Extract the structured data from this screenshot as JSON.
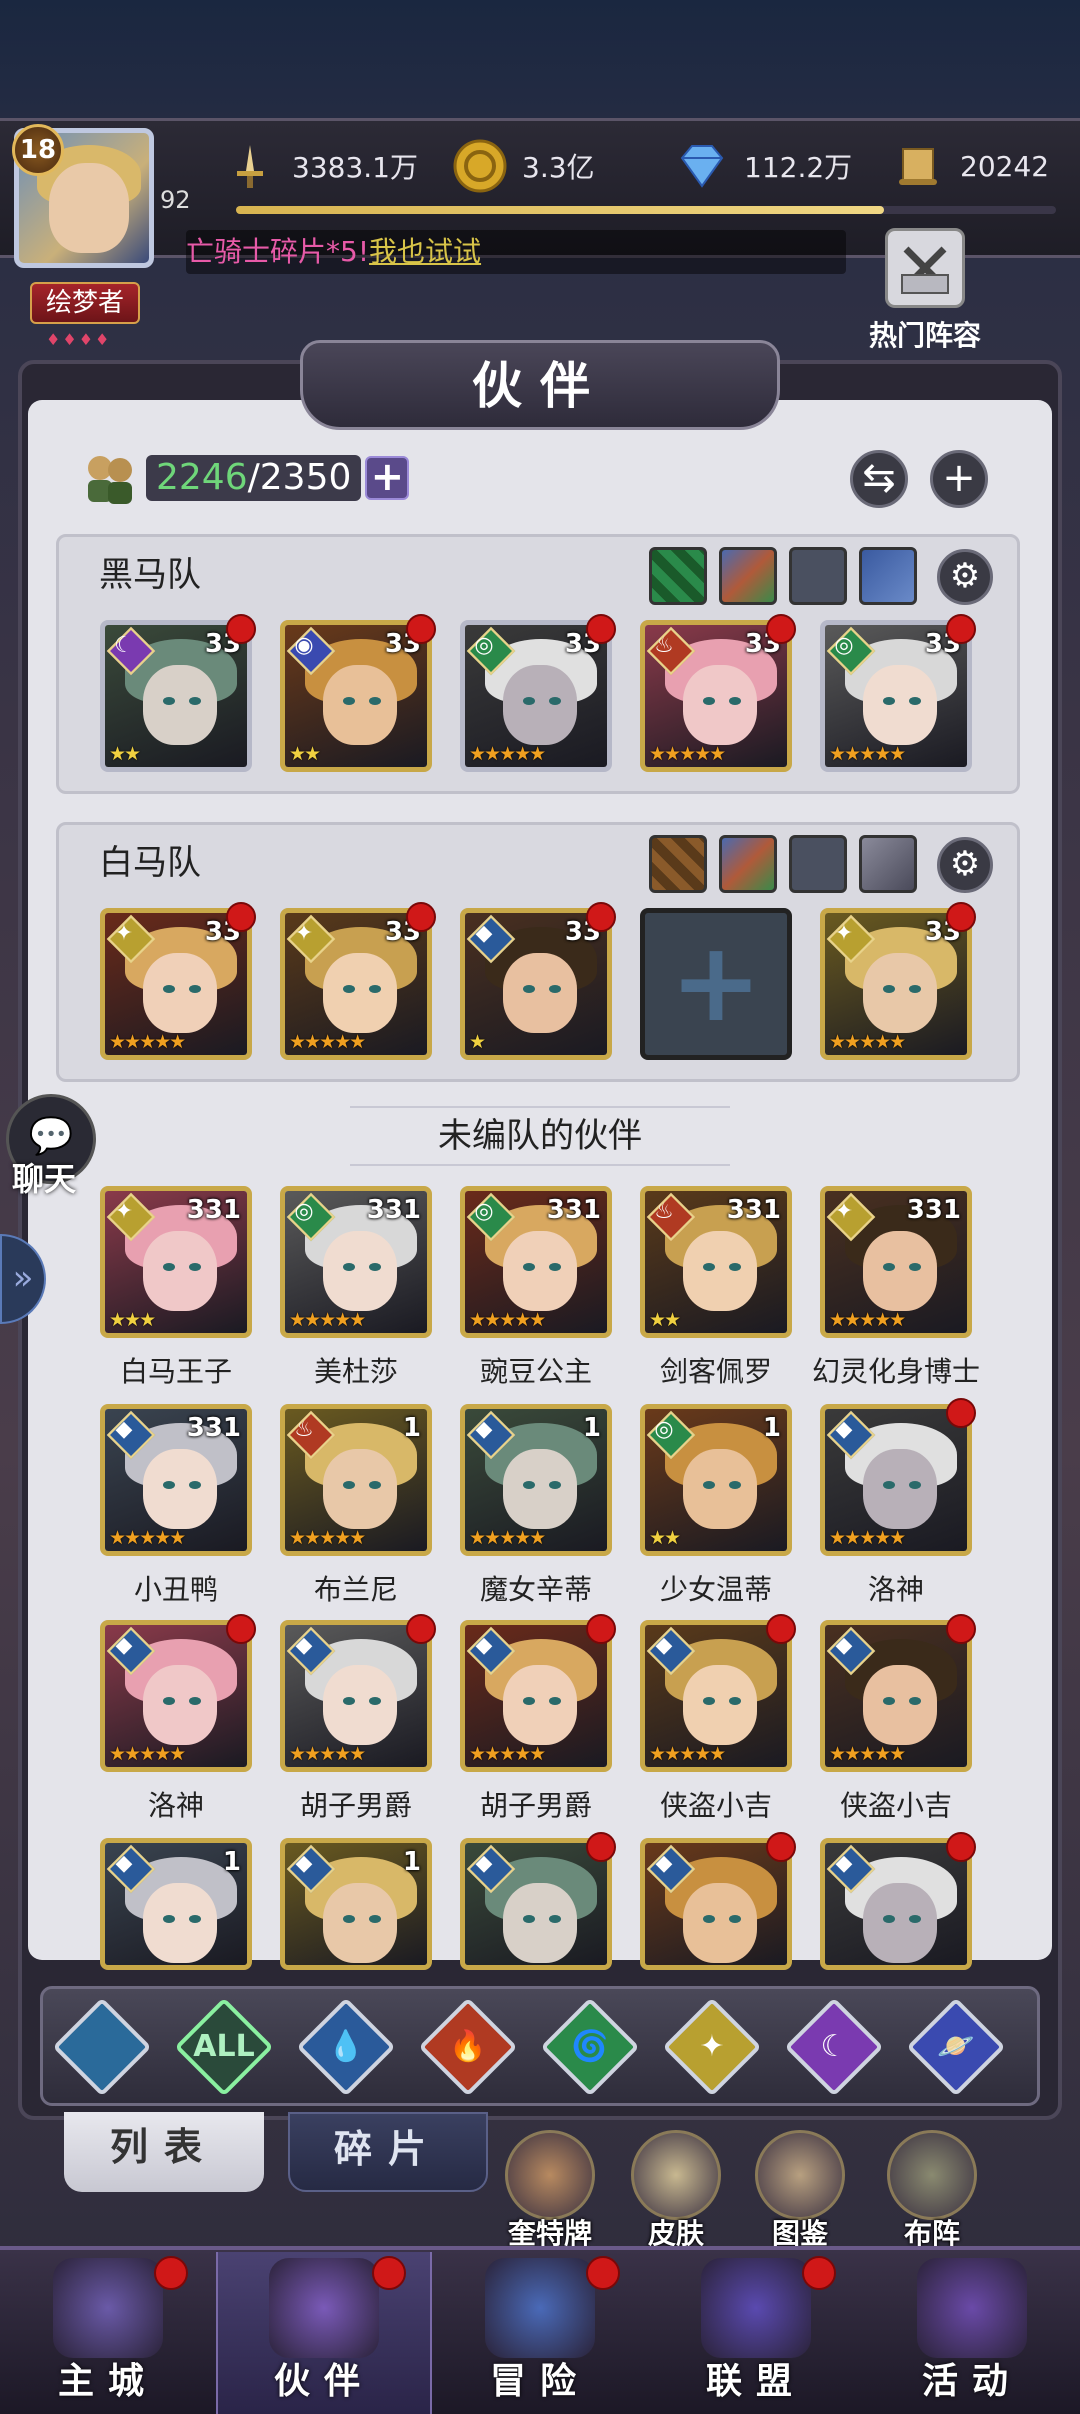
{
  "player": {
    "level": "18",
    "vip": "92",
    "title": "绘梦者",
    "title_dots": "♦♦♦♦",
    "exp_fraction": 0.79
  },
  "currencies": [
    {
      "icon": "sword-icon",
      "value": "3383.1万"
    },
    {
      "icon": "gold-coin-icon",
      "value": "3.3亿"
    },
    {
      "icon": "diamond-icon",
      "value": "112.2万"
    },
    {
      "icon": "scroll-icon",
      "value": "20242"
    }
  ],
  "ticker": {
    "part1": "亡骑士碎片*5!",
    "part2": "我也试试"
  },
  "hot_lineup_label": "热门阵容",
  "panel_title": "伙伴",
  "hero_count": {
    "current": "2246",
    "max": "/2350"
  },
  "teams": [
    {
      "name": "黑马队",
      "cards": [
        {
          "level": "33",
          "element": "moon",
          "stars": "★★",
          "frame": "silver"
        },
        {
          "level": "33",
          "element": "astral",
          "stars": "★★",
          "frame": "gold"
        },
        {
          "level": "33",
          "element": "wind",
          "stars": "★★★★★",
          "frame": "silver"
        },
        {
          "level": "33",
          "element": "fire",
          "stars": "★★★★★",
          "frame": "gold"
        },
        {
          "level": "33",
          "element": "wind",
          "stars": "★★★★★",
          "frame": "silver"
        }
      ]
    },
    {
      "name": "白马队",
      "cards": [
        {
          "level": "33",
          "element": "light",
          "stars": "★★★★★",
          "frame": "gold"
        },
        {
          "level": "33",
          "element": "light",
          "stars": "★★★★★",
          "frame": "gold"
        },
        {
          "level": "33",
          "element": "water",
          "stars": "★",
          "frame": "gold"
        },
        {
          "empty": true
        },
        {
          "level": "33",
          "element": "light",
          "stars": "★★★★★",
          "frame": "gold"
        }
      ]
    }
  ],
  "unassigned_label": "未编队的伙伴",
  "heroes": [
    {
      "name": "白马王子",
      "level": "331",
      "element": "light",
      "stars": "★★★",
      "dot": false
    },
    {
      "name": "美杜莎",
      "level": "331",
      "element": "wind",
      "stars": "★★★★★",
      "dot": false
    },
    {
      "name": "豌豆公主",
      "level": "331",
      "element": "wind",
      "stars": "★★★★★",
      "dot": false
    },
    {
      "name": "剑客佩罗",
      "level": "331",
      "element": "fire",
      "stars": "★★",
      "dot": false
    },
    {
      "name": "幻灵化身博士",
      "level": "331",
      "element": "light",
      "stars": "★★★★★",
      "dot": false
    },
    {
      "name": "小丑鸭",
      "level": "331",
      "element": "water",
      "stars": "★★★★★",
      "dot": false
    },
    {
      "name": "布兰尼",
      "level": "1",
      "element": "fire",
      "stars": "★★★★★",
      "dot": false
    },
    {
      "name": "魔女辛蒂",
      "level": "1",
      "element": "water",
      "stars": "★★★★★",
      "dot": false
    },
    {
      "name": "少女温蒂",
      "level": "1",
      "element": "wind",
      "stars": "★★",
      "dot": false
    },
    {
      "name": "洛神",
      "level": "",
      "element": "water",
      "stars": "★★★★★",
      "dot": true
    },
    {
      "name": "洛神",
      "level": "",
      "element": "water",
      "stars": "★★★★★",
      "dot": true
    },
    {
      "name": "胡子男爵",
      "level": "",
      "element": "water",
      "stars": "★★★★★",
      "dot": true
    },
    {
      "name": "胡子男爵",
      "level": "",
      "element": "water",
      "stars": "★★★★★",
      "dot": true
    },
    {
      "name": "侠盗小吉",
      "level": "",
      "element": "water",
      "stars": "★★★★★",
      "dot": true
    },
    {
      "name": "侠盗小吉",
      "level": "",
      "element": "water",
      "stars": "★★★★★",
      "dot": true
    },
    {
      "name": "",
      "level": "1",
      "element": "water",
      "stars": "",
      "dot": false
    },
    {
      "name": "",
      "level": "1",
      "element": "water",
      "stars": "",
      "dot": false
    },
    {
      "name": "",
      "level": "",
      "element": "water",
      "stars": "",
      "dot": true
    },
    {
      "name": "",
      "level": "",
      "element": "water",
      "stars": "",
      "dot": true
    },
    {
      "name": "",
      "level": "",
      "element": "water",
      "stars": "",
      "dot": true
    }
  ],
  "chat_label": "聊天",
  "filters": [
    {
      "icon": "generic-element-icon",
      "label": "",
      "color": "#2a6a9a"
    },
    {
      "icon": "all-element-icon",
      "label": "ALL",
      "color": "#2a4a3a"
    },
    {
      "icon": "water-drop-icon",
      "label": "💧",
      "color": "#2a5a9a"
    },
    {
      "icon": "fire-icon",
      "label": "🔥",
      "color": "#b03a22"
    },
    {
      "icon": "wind-icon",
      "label": "🌀",
      "color": "#2a8a4a"
    },
    {
      "icon": "light-star-icon",
      "label": "✦",
      "color": "#b8a030"
    },
    {
      "icon": "moon-icon",
      "label": "☾",
      "color": "#7a3ab0"
    },
    {
      "icon": "astral-planet-icon",
      "label": "🪐",
      "color": "#3a4ab0"
    }
  ],
  "sub_tabs": {
    "list": "列表",
    "fragments": "碎片"
  },
  "tools": [
    {
      "label": "奎特牌",
      "icon": "tarot-cards-icon"
    },
    {
      "label": "皮肤",
      "icon": "outfit-icon"
    },
    {
      "label": "图鉴",
      "icon": "codex-icon"
    },
    {
      "label": "布阵",
      "icon": "formation-icon"
    }
  ],
  "nav": [
    {
      "label": "主城",
      "icon": "castle-icon",
      "dot": true
    },
    {
      "label": "伙伴",
      "icon": "wizard-hat-icon",
      "dot": true
    },
    {
      "label": "冒险",
      "icon": "compass-icon",
      "dot": true
    },
    {
      "label": "联盟",
      "icon": "shield-icon",
      "dot": true
    },
    {
      "label": "活动",
      "icon": "cards-icon",
      "dot": false
    }
  ]
}
